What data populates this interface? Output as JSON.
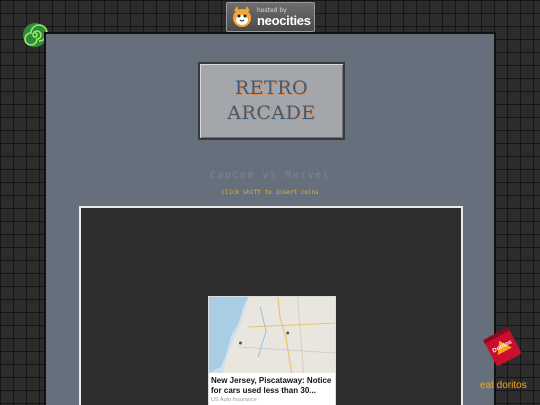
{
  "badge": {
    "line1": "hosted by",
    "line2": "neocities",
    "icon": "neocities-cat-icon"
  },
  "decor": {
    "spiral_icon": "green-spiral-icon",
    "doritos_icon": "doritos-bag-icon",
    "doritos_bag_text": "Doritos"
  },
  "title": {
    "line1": "RETRO",
    "line2": "ARCADE"
  },
  "game": {
    "name": "CapCom vs Marvel",
    "hint": "click shift to insert coins"
  },
  "ad": {
    "headline": "New Jersey, Piscataway: Notice for cars used less than 30...",
    "source": "US Auto Insurance",
    "image": "map-thumbnail"
  },
  "footer": {
    "eat_label": "eat doritos"
  },
  "colors": {
    "panel": "#66707c",
    "title_text": "#3e5a7c",
    "hint": "#e0b43a",
    "eat": "#f5a623"
  }
}
